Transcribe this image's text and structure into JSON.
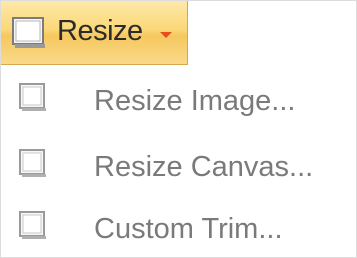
{
  "ribbon": {
    "resize_label": "Resize",
    "resize_icon": "resize-icon",
    "dropdown_icon": "chevron-down-icon",
    "accent_color": "#f9d27a"
  },
  "menu": {
    "items": [
      {
        "label": "Resize Image...",
        "icon": "resize-image-icon"
      },
      {
        "label": "Resize Canvas...",
        "icon": "resize-canvas-icon"
      },
      {
        "label": "Custom Trim...",
        "icon": "custom-trim-icon"
      }
    ]
  }
}
